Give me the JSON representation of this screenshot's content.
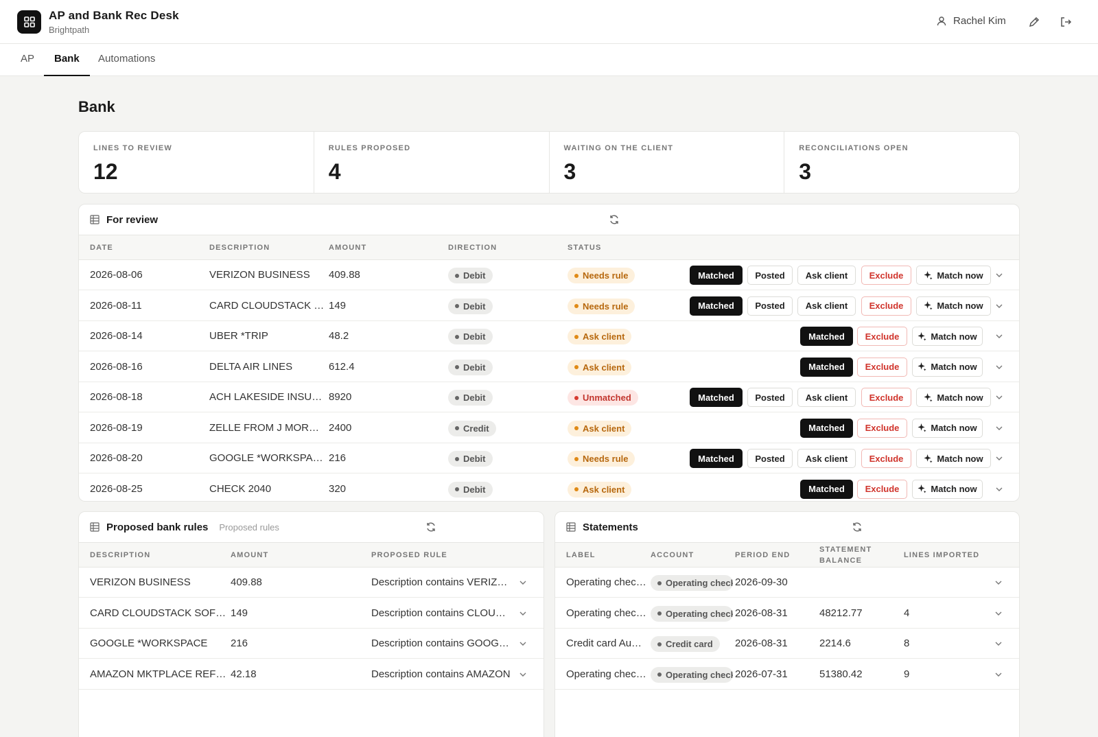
{
  "header": {
    "app_title": "AP and Bank Rec Desk",
    "org": "Brightpath",
    "user_name": "Rachel Kim"
  },
  "tabs": [
    {
      "label": "AP"
    },
    {
      "label": "Bank",
      "active": true
    },
    {
      "label": "Automations"
    }
  ],
  "page_title": "Bank",
  "stats": [
    {
      "label": "LINES TO REVIEW",
      "value": "12"
    },
    {
      "label": "RULES PROPOSED",
      "value": "4"
    },
    {
      "label": "WAITING ON THE CLIENT",
      "value": "3"
    },
    {
      "label": "RECONCILIATIONS OPEN",
      "value": "3"
    }
  ],
  "review": {
    "title": "For review",
    "columns": [
      "DATE",
      "DESCRIPTION",
      "AMOUNT",
      "DIRECTION",
      "STATUS"
    ],
    "actions": {
      "matched": "Matched",
      "posted": "Posted",
      "ask_client": "Ask client",
      "exclude": "Exclude",
      "match_now": "Match now"
    },
    "rows": [
      {
        "date": "2026-08-06",
        "description": "VERIZON BUSINESS",
        "amount": "409.88",
        "direction": "Debit",
        "status": "Needs rule",
        "status_tone": "amber",
        "full_actions": true
      },
      {
        "date": "2026-08-11",
        "description": "CARD CLOUDSTACK SOFTWARE",
        "amount": "149",
        "direction": "Debit",
        "status": "Needs rule",
        "status_tone": "amber",
        "full_actions": true
      },
      {
        "date": "2026-08-14",
        "description": "UBER *TRIP",
        "amount": "48.2",
        "direction": "Debit",
        "status": "Ask client",
        "status_tone": "amber",
        "full_actions": false
      },
      {
        "date": "2026-08-16",
        "description": "DELTA AIR LINES",
        "amount": "612.4",
        "direction": "Debit",
        "status": "Ask client",
        "status_tone": "amber",
        "full_actions": false
      },
      {
        "date": "2026-08-18",
        "description": "ACH LAKESIDE INSURANCE",
        "amount": "8920",
        "direction": "Debit",
        "status": "Unmatched",
        "status_tone": "red",
        "full_actions": true
      },
      {
        "date": "2026-08-19",
        "description": "ZELLE FROM J MORALES",
        "amount": "2400",
        "direction": "Credit",
        "status": "Ask client",
        "status_tone": "amber",
        "full_actions": false
      },
      {
        "date": "2026-08-20",
        "description": "GOOGLE *WORKSPACE",
        "amount": "216",
        "direction": "Debit",
        "status": "Needs rule",
        "status_tone": "amber",
        "full_actions": true
      },
      {
        "date": "2026-08-25",
        "description": "CHECK 2040",
        "amount": "320",
        "direction": "Debit",
        "status": "Ask client",
        "status_tone": "amber",
        "full_actions": false
      }
    ]
  },
  "rules": {
    "title": "Proposed bank rules",
    "subtitle": "Proposed rules",
    "columns": [
      "DESCRIPTION",
      "AMOUNT",
      "PROPOSED RULE"
    ],
    "rows": [
      {
        "description": "VERIZON BUSINESS",
        "amount": "409.88",
        "rule": "Description contains VERIZON BUSINESS"
      },
      {
        "description": "CARD CLOUDSTACK SOFTWARE",
        "amount": "149",
        "rule": "Description contains CLOUDSTACK"
      },
      {
        "description": "GOOGLE *WORKSPACE",
        "amount": "216",
        "rule": "Description contains GOOGLE"
      },
      {
        "description": "AMAZON MKTPLACE REFUND",
        "amount": "42.18",
        "rule": "Description contains AMAZON"
      }
    ]
  },
  "statements": {
    "title": "Statements",
    "columns": [
      "LABEL",
      "ACCOUNT",
      "PERIOD END",
      "STATEMENT BALANCE",
      "LINES IMPORTED"
    ],
    "rows": [
      {
        "label": "Operating checking",
        "account": "Operating checking",
        "period_end": "2026-09-30",
        "balance": "",
        "lines": ""
      },
      {
        "label": "Operating checking",
        "account": "Operating checking",
        "period_end": "2026-08-31",
        "balance": "48212.77",
        "lines": "4"
      },
      {
        "label": "Credit card August",
        "account": "Credit card",
        "period_end": "2026-08-31",
        "balance": "2214.6",
        "lines": "8"
      },
      {
        "label": "Operating checking",
        "account": "Operating checking",
        "period_end": "2026-07-31",
        "balance": "51380.42",
        "lines": "9"
      }
    ]
  }
}
